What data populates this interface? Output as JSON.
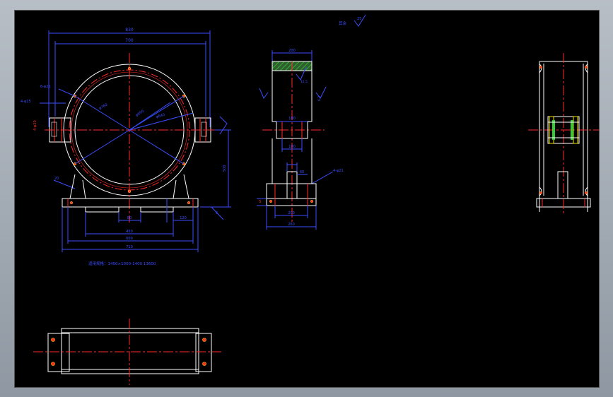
{
  "drawing": {
    "colors": {
      "outline": "#ffffff",
      "dimension": "#3b4dff",
      "centerline": "#ff2a2a",
      "hatch": "#33cc33",
      "hatch_fill": "#2f5f2f",
      "background": "#000000",
      "frame_bg": "#9aa3ad",
      "bolt": "#f2e400"
    },
    "front_view": {
      "dims": {
        "top_outer": "830",
        "top_inner": "700",
        "dia_outer": "φ760",
        "dia_mid": "φ690",
        "dia_inner": "φ640",
        "side_hole": "4-φ20",
        "flange_hole": "6-φ25",
        "corner_hole": "4-φ15",
        "center_height": "500",
        "rib": "20",
        "foot_inner": "450",
        "foot_mid": "600",
        "foot_outer": "710",
        "foot_small": "120",
        "foot_slot": "80",
        "weld_ref": "6"
      },
      "note": "适用规格：1400×1000-1400  13600"
    },
    "side_view": {
      "dims": {
        "top_width": "200",
        "mid_width": "180",
        "lower_width": "100",
        "pin_width": "60",
        "slot_width": "100",
        "base_inner": "200",
        "base_outer": "260",
        "height_ref": "5",
        "chamfer": "4-φ21",
        "roughness_a": "12.5",
        "roughness_b": "6.3"
      }
    },
    "roughness_note": {
      "label": "其余",
      "value": "25"
    }
  }
}
